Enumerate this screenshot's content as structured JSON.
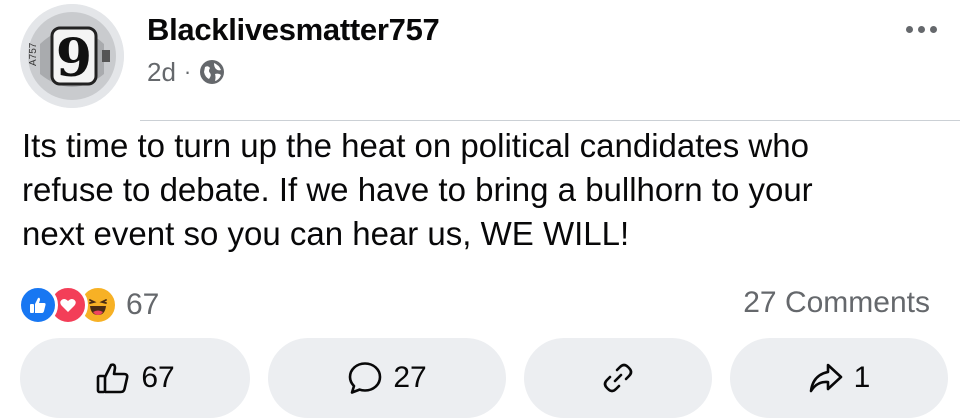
{
  "post": {
    "author": "Blacklivesmatter757",
    "time": "2d",
    "separator": "·",
    "audience_icon": "globe-icon",
    "more_icon": "more-options-icon",
    "avatar": {
      "badge_text": "9",
      "side_text": "A757"
    },
    "text": "Its time to turn up the heat on political candidates who\nrefuse to debate. If we have to bring a bullhorn to your\nnext event so you can hear us, WE WILL!"
  },
  "stats": {
    "reaction_icons": [
      "like-reaction-icon",
      "love-reaction-icon",
      "haha-reaction-icon"
    ],
    "reaction_count": "67",
    "comments_label": "27 Comments"
  },
  "actions": {
    "like": {
      "icon": "thumbs-up-icon",
      "count": "67"
    },
    "comment": {
      "icon": "comment-bubble-icon",
      "count": "27"
    },
    "link": {
      "icon": "link-icon"
    },
    "share": {
      "icon": "share-arrow-icon",
      "count": "1"
    }
  },
  "colors": {
    "like_blue": "#1877f2",
    "love_red": "#f33e58",
    "haha_yellow": "#f7b125",
    "secondary_text": "#65686c",
    "button_bg": "#eceef1"
  }
}
